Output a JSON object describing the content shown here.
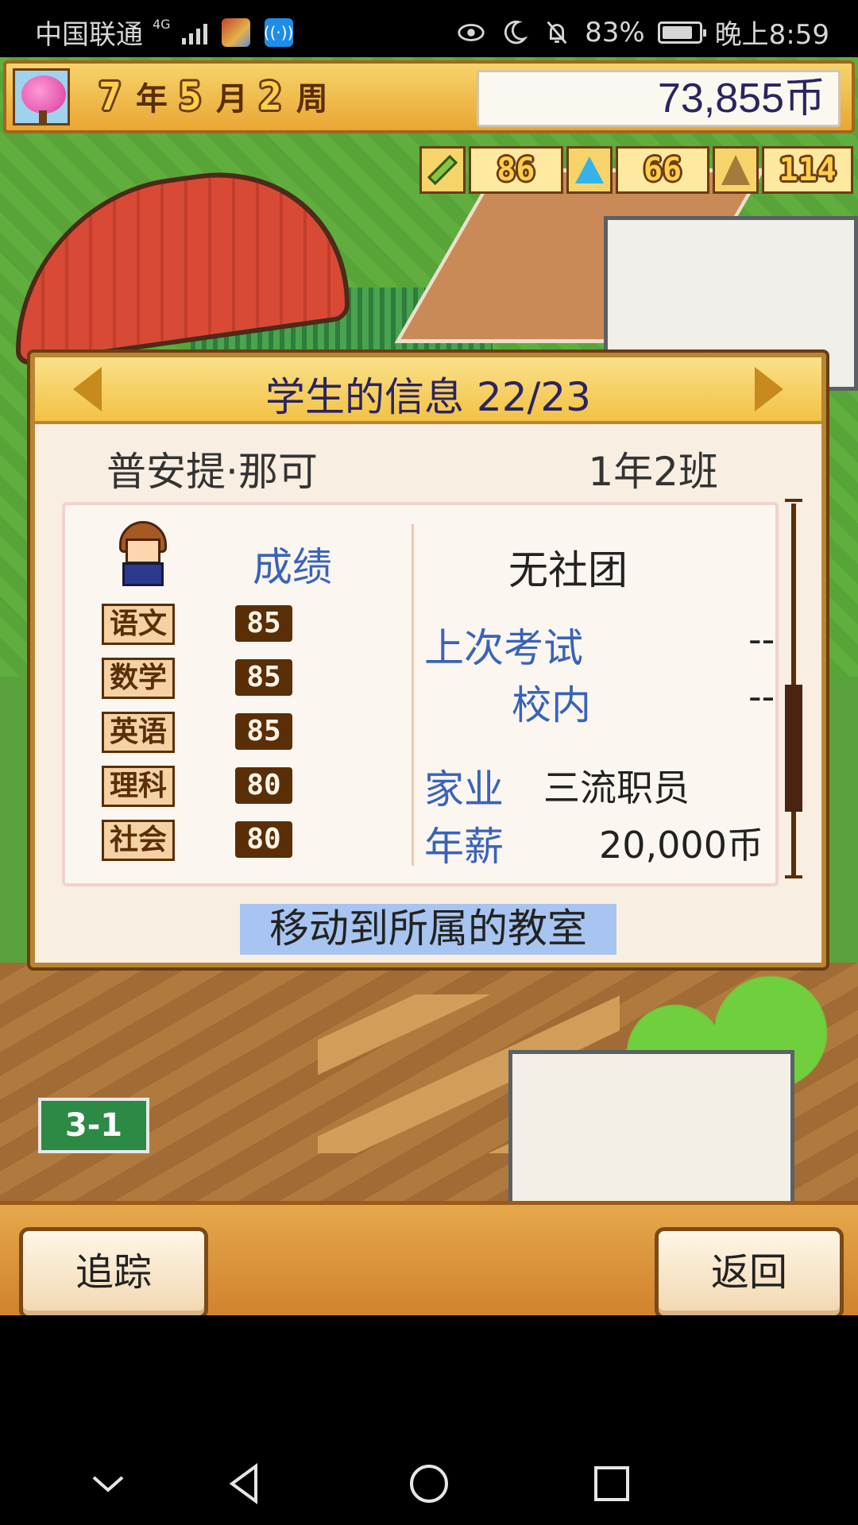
{
  "status_bar": {
    "carrier": "中国联通",
    "network": "4G",
    "battery_percent": "83%",
    "battery_level": 0.83,
    "time": "晚上8:59"
  },
  "hud": {
    "year_value": "7",
    "year_unit": "年",
    "month_value": "5",
    "month_unit": "月",
    "week_value": "2",
    "week_unit": "周",
    "money": "73,855币",
    "stats": [
      {
        "icon": "pencil-icon",
        "value": "86"
      },
      {
        "icon": "flask-icon",
        "value": "66"
      },
      {
        "icon": "tower-icon",
        "value": "114"
      }
    ]
  },
  "dialog": {
    "title": "学生的信息 22/23",
    "student_name": "普安提·那可",
    "student_class": "1年2班",
    "grades_label": "成绩",
    "subjects": [
      {
        "label": "语文",
        "score": "85"
      },
      {
        "label": "数学",
        "score": "85"
      },
      {
        "label": "英语",
        "score": "85"
      },
      {
        "label": "理科",
        "score": "80"
      },
      {
        "label": "社会",
        "score": "80"
      }
    ],
    "club": "无社团",
    "last_exam_label": "上次考试",
    "last_exam_value": "--",
    "school_rank_label": "校内",
    "school_rank_value": "--",
    "family_job_label": "家业",
    "family_job_value": "三流职员",
    "salary_label": "年薪",
    "salary_value": "20,000币",
    "move_button": "移动到所属的教室"
  },
  "bottom": {
    "track_label": "追踪",
    "back_label": "返回"
  },
  "scene": {
    "classroom_sign": "3-1"
  }
}
